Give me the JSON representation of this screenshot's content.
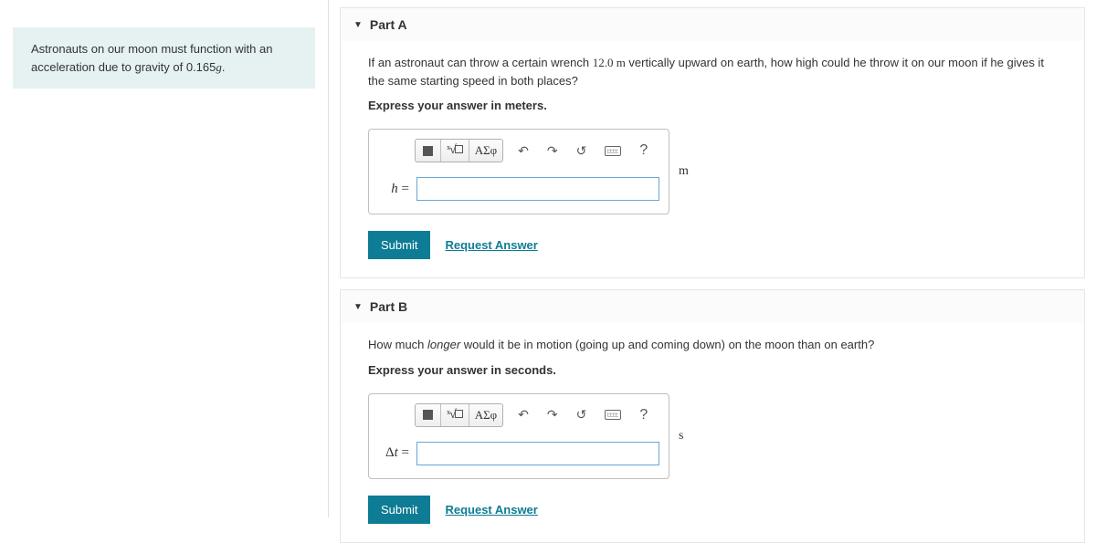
{
  "problem": {
    "text_before": "Astronauts on our moon must function with an acceleration due to gravity of ",
    "value": "0.165",
    "var": "g",
    "text_after": "."
  },
  "parts": [
    {
      "title": "Part A",
      "question_before": "If an astronaut can throw a certain wrench ",
      "question_value": "12.0 m",
      "question_after": " vertically upward on earth, how high could he throw it on our moon if he gives it the same starting speed in both places?",
      "instruction": "Express your answer in meters.",
      "label_html": "h =",
      "unit": "m",
      "submit": "Submit",
      "request": "Request Answer"
    },
    {
      "title": "Part B",
      "question_before": "How much ",
      "question_em": "longer",
      "question_after": " would it be in motion (going up and coming down) on the moon than on earth?",
      "instruction": "Express your answer in seconds.",
      "label_html": "Δt =",
      "unit": "s",
      "submit": "Submit",
      "request": "Request Answer"
    }
  ],
  "toolbar": {
    "greek": "ΑΣφ",
    "help": "?"
  }
}
